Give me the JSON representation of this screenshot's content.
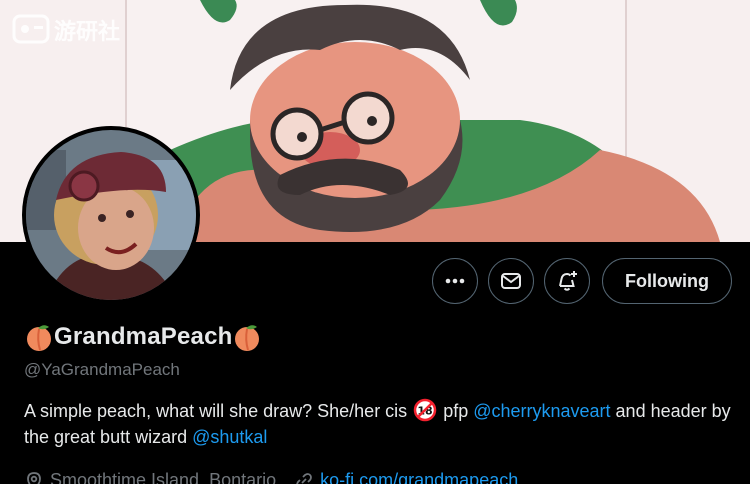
{
  "watermark": {
    "text": "游研社"
  },
  "actions": {
    "more": "more-icon",
    "message": "mail-icon",
    "notify": "bell-plus-icon",
    "following_label": "Following"
  },
  "profile": {
    "display_name": "GrandmaPeach",
    "handle": "@YaGrandmaPeach",
    "bio": {
      "part1": "A simple peach, what will she draw? She/her cis ",
      "badge": "18",
      "part2": " pfp ",
      "mention1": "@cherryknaveart",
      "part3": " and header by the great butt wizard ",
      "mention2": "@shutkal"
    },
    "location": "Smoothtime Island, Bontario",
    "website": "ko-fi.com/grandmapeach"
  },
  "colors": {
    "accent": "#1d9bf0",
    "muted": "#71767b",
    "border": "#536471",
    "badge": "#f4212e"
  }
}
